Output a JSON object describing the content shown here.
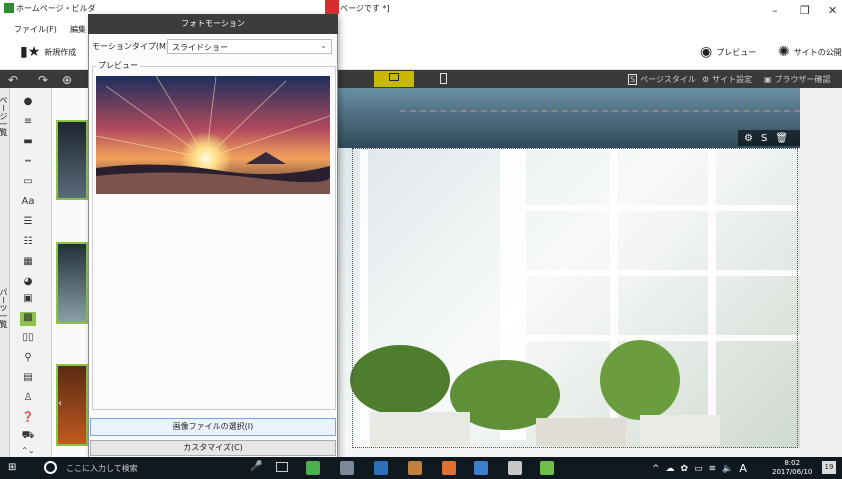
{
  "window": {
    "title_left": "ホームページ・ビルダ",
    "title_right": "ページです *]",
    "minimize": "–",
    "restore": "❐",
    "close": "✕"
  },
  "menu": [
    "ファイル(F)",
    "編集"
  ],
  "toolbar": {
    "new_label": "新規作成",
    "preview_label": "プレビュー",
    "publish_label": "サイトの公開"
  },
  "darkbar": {
    "undo": "↶",
    "redo": "↷",
    "zoom": "⊕",
    "page_style": "ページスタイル",
    "site_settings": "サイト設定",
    "browser_check": "ブラウザー確認"
  },
  "sidebar": {
    "pages_tab": "ページ一覧",
    "parts_tab": "パーツ一覧"
  },
  "dialog": {
    "title": "フォトモーション",
    "motion_type_label": "モーションタイプ(M)",
    "motion_type_value": "スライドショー",
    "preview_label": "プレビュー",
    "select_image_button": "画像ファイルの選択(I)",
    "customize_button": "カスタマイズ(C)"
  },
  "taskbar": {
    "search_placeholder": "ここに入力して検索",
    "ime": "A",
    "time": "8:02",
    "date": "2017/06/10",
    "notif_count": "19"
  },
  "colors": {
    "accent_green": "#8bc34a",
    "dark_strip": "#3a3a3a",
    "taskbar": "#101820"
  }
}
